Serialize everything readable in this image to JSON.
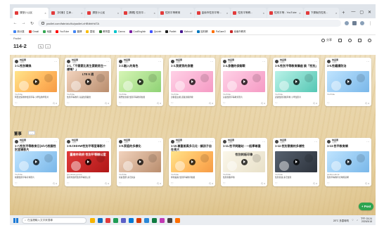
{
  "browser": {
    "tabs": [
      {
        "label": "課堂小公民",
        "color": "#e23b3b",
        "active": true
      },
      {
        "label": "【均衡】生命...",
        "color": "#e23b3b"
      },
      {
        "label": "課堂小公民",
        "color": "#e23b3b"
      },
      {
        "label": "[專題] 性別平...",
        "color": "#e23b3b"
      },
      {
        "label": "性別平等教育",
        "color": "#e23b3b"
      },
      {
        "label": "臺南市性別平等...",
        "color": "#e23b3b"
      },
      {
        "label": "性別平等教...",
        "color": "#e23b3b"
      },
      {
        "label": "性別平等 - YouTube",
        "color": "#e23b3b"
      },
      {
        "label": "下課後的性別...",
        "color": "#e23b3b"
      }
    ],
    "new_tab": "+",
    "window_controls": [
      "—",
      "▢",
      "✕"
    ],
    "address": "padlet.com/fabrizio/liu/padlet-xHBtbhHdTA",
    "bookmarks": [
      {
        "label": "新分頁",
        "color": "#4285f4"
      },
      {
        "label": "Gmail",
        "color": "#ea4335"
      },
      {
        "label": "地圖",
        "color": "#34a853"
      },
      {
        "label": "YouTube",
        "color": "#ff0000"
      },
      {
        "label": "翻譯",
        "color": "#4285f4"
      },
      {
        "label": "雲端",
        "color": "#fbbc04"
      },
      {
        "label": "教育雲",
        "color": "#2e7d32"
      },
      {
        "label": "Canva",
        "color": "#00c4cc"
      },
      {
        "label": "CoolEnglish",
        "color": "#7b1fa2"
      },
      {
        "label": "Quizlet",
        "color": "#4255ff"
      },
      {
        "label": "Padlet",
        "color": "#1f1f1f"
      },
      {
        "label": "Kahoot!",
        "color": "#46178f"
      },
      {
        "label": "因材網",
        "color": "#0277bd"
      },
      {
        "label": "PaGamO",
        "color": "#ff6f00"
      },
      {
        "label": "臺南市教育",
        "color": "#c62828"
      }
    ]
  },
  "padlet": {
    "brand": "Padlet",
    "board_title": "114-2",
    "header_buttons": [
      {
        "label": "分享",
        "icon": "share-icon"
      },
      {
        "label": "",
        "icon": "search-icon"
      },
      {
        "label": "",
        "icon": "bell-icon"
      },
      {
        "label": "",
        "icon": "gear-icon"
      },
      {
        "label": "",
        "icon": "more-icon"
      }
    ],
    "sections": [
      {
        "title": "",
        "cards": [
          {
            "author": "林孟燕",
            "ago": "3週前",
            "title": "1-1.性別轉換",
            "source": "YouTube",
            "desc": "阿西法官教你性別平等 小學生教學影片",
            "likes": "♡",
            "comments": "0",
            "art": "t-bright",
            "label": ""
          },
          {
            "author": "林孟燕",
            "ago": "3週前",
            "title": "1-1.「不需要比男生要跟男生一樣嗎？」",
            "source": "YouTube",
            "desc": "性別平等教育 兒童性別觀念",
            "likes": "♡",
            "comments": "0",
            "art": "t-face",
            "label": "LTE 6 週"
          },
          {
            "author": "林孟燕",
            "ago": "3週前",
            "title": "1-2.融入的角色",
            "source": "YouTube",
            "desc": "我們的身體 性別平等教育動畫",
            "likes": "♡",
            "comments": "0",
            "art": "t-green",
            "label": ""
          },
          {
            "author": "林孟燕",
            "ago": "3週前",
            "title": "1-3.我愛我的身體",
            "source": "YouTube",
            "desc": "身體自主權 認識身體界線",
            "likes": "♡",
            "comments": "0",
            "art": "t-pink",
            "label": ""
          },
          {
            "author": "林孟燕",
            "ago": "3週前",
            "title": "1-4.身體的保衛戰",
            "source": "YouTube",
            "desc": "兒童性別平等教育影片",
            "likes": "♡",
            "comments": "0",
            "art": "t-pink",
            "label": ""
          },
          {
            "author": "林孟燕",
            "ago": "3週前",
            "title": "1-5.性別平等教育講座 談「性別」",
            "source": "YouTube",
            "desc": "認識性別刻板印象 小學生影片",
            "likes": "♡",
            "comments": "0",
            "art": "t-teal",
            "label": ""
          },
          {
            "author": "林孟燕",
            "ago": "3週前",
            "title": "1-6.性騷擾防治",
            "source": "YouTube",
            "desc": "",
            "likes": "♡",
            "comments": "0",
            "art": "t-blue",
            "label": ""
          }
        ]
      },
      {
        "title": "董事",
        "cards": [
          {
            "author": "林孟燕",
            "ago": "2週前",
            "title": "1-7.性別平等教育日(3/17)校園性別宣導影片",
            "source": "YouTube",
            "desc": "校園性別平等宣導影片",
            "likes": "♡",
            "comments": "0",
            "art": "t-blue",
            "label": ""
          },
          {
            "author": "林孟燕",
            "ago": "2週前",
            "title": "1-8.CEDAW性別平等宣導影片",
            "source": "gov.tainan.gov.tw",
            "desc": "臺南市政府性別平等辦公室",
            "likes": "♡",
            "comments": "0",
            "art": "t-red",
            "label": "臺南市政府 性別平等辦公室"
          },
          {
            "author": "林孟燕",
            "ago": "2週前",
            "title": "1-9.家庭的多樣化",
            "source": "YouTube",
            "desc": "家庭型態 多元家庭",
            "likes": "♡",
            "comments": "0",
            "art": "t-face",
            "label": ""
          },
          {
            "author": "林孟燕",
            "ago": "2週前",
            "title": "1-10.尊重差異多元化 - 讓孩子自在長大",
            "source": "YouTube",
            "desc": "尊重差異 性別平等教育動畫",
            "likes": "♡",
            "comments": "0",
            "art": "t-bright",
            "label": ""
          },
          {
            "author": "林孟燕",
            "ago": "2週前",
            "title": "1-11.性平問題站 - 一起學尊重",
            "source": "YouTube",
            "desc": "性別刻板印象",
            "likes": "♡",
            "comments": "0",
            "art": "t-paper",
            "label": "性別刻板印象"
          },
          {
            "author": "林孟燕",
            "ago": "2週前",
            "title": "1-12.性別意識的多樣性",
            "source": "YouTube",
            "desc": "性別意識 多元性別",
            "likes": "♡",
            "comments": "0",
            "art": "t-dark",
            "label": ""
          },
          {
            "author": "林孟燕",
            "ago": "2週前",
            "title": "1-13.性平教育網",
            "source": "gender.edu.tw",
            "desc": "性別平等教育全球資訊網",
            "likes": "♡",
            "comments": "0",
            "art": "t-blue",
            "label": ""
          }
        ]
      }
    ],
    "post_button": "+ Post"
  },
  "taskbar": {
    "search_placeholder": "在這裡輸入文字來搜尋",
    "weather": "28°C 多雲時晴",
    "time": "下午 03:24",
    "date": "2025/3/18",
    "apps": [
      "#f6b400",
      "#0f6cbd",
      "#e23b3b",
      "#1f9d55",
      "#5b5fc7",
      "#0078d4",
      "#d83b01",
      "#2b88d8",
      "#107c41",
      "#c239b3",
      "#444444",
      "#ff6f00"
    ]
  }
}
